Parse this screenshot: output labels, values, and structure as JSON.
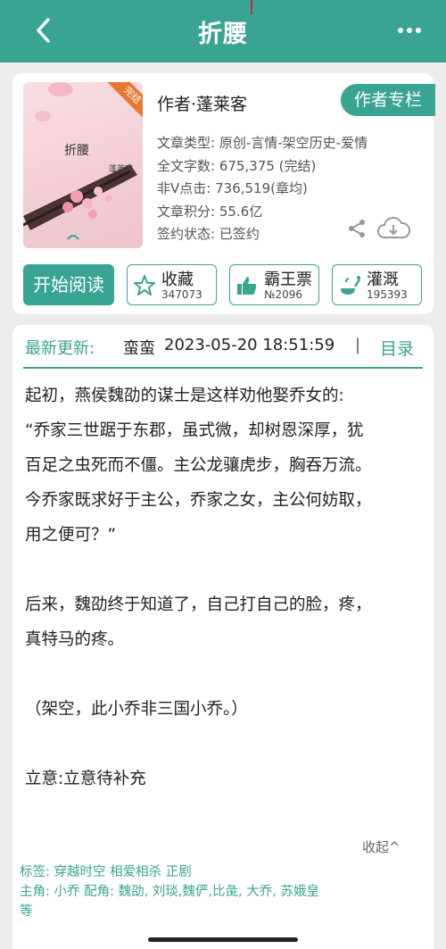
{
  "header": {
    "title": "折腰"
  },
  "book": {
    "cover_title": "折腰",
    "cover_author": "蓬莱客",
    "cover_badge": "完结",
    "author_line": "作者·蓬莱客",
    "author_column_label": "作者专栏",
    "meta": [
      {
        "label": "文章类型:",
        "value": "原创-言情-架空历史-爱情"
      },
      {
        "label": "全文字数:",
        "value": "675,375 (完结)"
      },
      {
        "label": "非V点击:",
        "value": "736,519(章均)"
      },
      {
        "label": "文章积分:",
        "value": "55.6亿"
      },
      {
        "label": "签约状态:",
        "value": "已签约"
      }
    ]
  },
  "actions": {
    "start_reading": "开始阅读",
    "favorite": {
      "label": "收藏",
      "count": "347073"
    },
    "overlord": {
      "label": "霸王票",
      "count": "№2096"
    },
    "nutrient": {
      "label": "灌溉",
      "count": "195393"
    }
  },
  "update": {
    "label": "最新更新:",
    "chapter": "蛮蛮",
    "datetime": "2023-05-20 18:51:59",
    "separator": "|",
    "toc": "目录"
  },
  "intro": {
    "lines": [
      "起初，燕侯魏劭的谋士是这样劝他娶乔女的:",
      "“乔家三世踞于东郡，虽式微，却树恩深厚，犹",
      "百足之虫死而不僵。主公龙骧虎步，胸吞万流。",
      "今乔家既求好于主公，乔家之女，主公何妨取，",
      "用之便可？”",
      "",
      "后来，魏劭终于知道了，自己打自己的脸，疼，",
      "真特马的疼。",
      "",
      "（架空，此小乔非三国小乔。）",
      "",
      "立意:立意待补充"
    ],
    "collapse": "收起^"
  },
  "tags": {
    "tags_line": "标签:  穿越时空 相爱相杀 正剧",
    "roles_line": "主角:  小乔       配角:  魏劭, 刘琰,魏俨,比彘, 大乔, 苏娥皇",
    "roles_tail": "等"
  },
  "colors": {
    "accent": "#3aa493",
    "background": "#ececec"
  },
  "icons": [
    "back-icon",
    "more-icon",
    "share-icon",
    "download-icon",
    "star-icon",
    "thumbs-up-icon",
    "watering-icon"
  ]
}
